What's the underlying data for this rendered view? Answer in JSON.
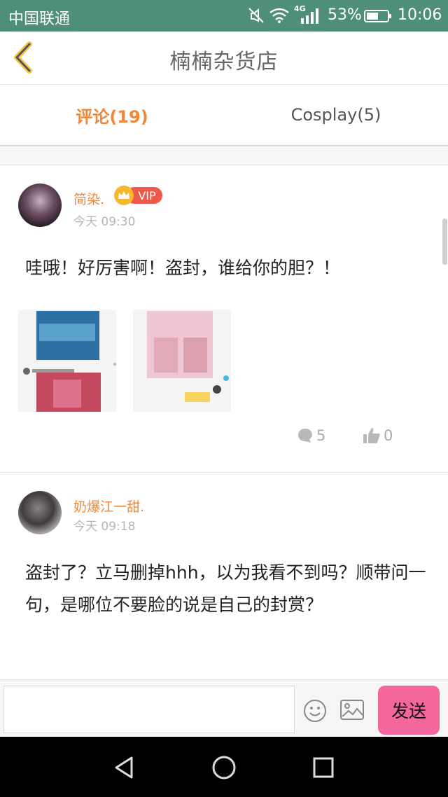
{
  "status_bar": {
    "carrier": "中国联通",
    "network": "4G",
    "battery_pct": "53%",
    "clock": "10:06",
    "icons": [
      "mute-icon",
      "wifi-icon",
      "signal-icon",
      "battery-icon"
    ]
  },
  "header": {
    "title": "楠楠杂货店",
    "back_icon": "chevron-left-icon",
    "accent_color": "#f0883a"
  },
  "tabs": [
    {
      "label": "评论(19)",
      "active": true
    },
    {
      "label": "Cosplay(5)",
      "active": false
    }
  ],
  "comments": [
    {
      "username": "简染.",
      "badge": "VIP",
      "time": "今天 09:30",
      "text": "哇哦！好厉害啊！盗封，谁给你的胆？！",
      "images": [
        "cover-thumbnail-1",
        "cover-thumbnail-2"
      ],
      "comment_count": "5",
      "like_count": "0"
    },
    {
      "username": "奶爆江一甜.",
      "time": "今天 09:18",
      "text": "盗封了？立马删掉hhh，以为我看不到吗？顺带问一句，是哪位不要脸的说是自己的封赏？"
    }
  ],
  "input_bar": {
    "placeholder": "",
    "send_label": "发送",
    "send_color": "#f4679c"
  },
  "nav_bar": {
    "icons": [
      "back-triangle-icon",
      "home-circle-icon",
      "recents-square-icon"
    ]
  }
}
